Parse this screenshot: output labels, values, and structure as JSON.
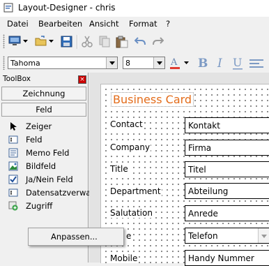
{
  "window": {
    "title": "Layout-Designer - chris"
  },
  "menu": [
    "Datei",
    "Bearbeiten",
    "Ansicht",
    "Format",
    "?"
  ],
  "format": {
    "font": "Tahoma",
    "size": "8"
  },
  "toolbox": {
    "title": "ToolBox",
    "tabs": [
      "Zeichnung",
      "Feld"
    ],
    "tools": [
      {
        "label": "Zeiger",
        "icon": "pointer-icon"
      },
      {
        "label": "Feld",
        "icon": "text-field-icon"
      },
      {
        "label": "Memo Feld",
        "icon": "memo-field-icon"
      },
      {
        "label": "Bildfeld",
        "icon": "image-field-icon"
      },
      {
        "label": "Ja/Nein Feld",
        "icon": "checkbox-field-icon"
      },
      {
        "label": "Datensatzverwal",
        "icon": "record-manager-icon"
      },
      {
        "label": "Zugriff",
        "icon": "access-icon"
      }
    ],
    "context_menu_item": "Anpassen..."
  },
  "card": {
    "title": "Business Card",
    "fields": [
      {
        "label": "Contact",
        "value": "Kontakt"
      },
      {
        "label": "Company",
        "value": "Firma"
      },
      {
        "label": "Title",
        "value": "Titel"
      },
      {
        "label": "Department",
        "value": "Abteilung"
      },
      {
        "label": "Salutation",
        "value": "Anrede"
      },
      {
        "label": "e",
        "value": "Telefon"
      },
      {
        "label": "Mobile",
        "value": "Handy Nummer"
      }
    ]
  },
  "colors": {
    "card_title": "#e36c1a",
    "font_color_bar": "#e03c31"
  }
}
